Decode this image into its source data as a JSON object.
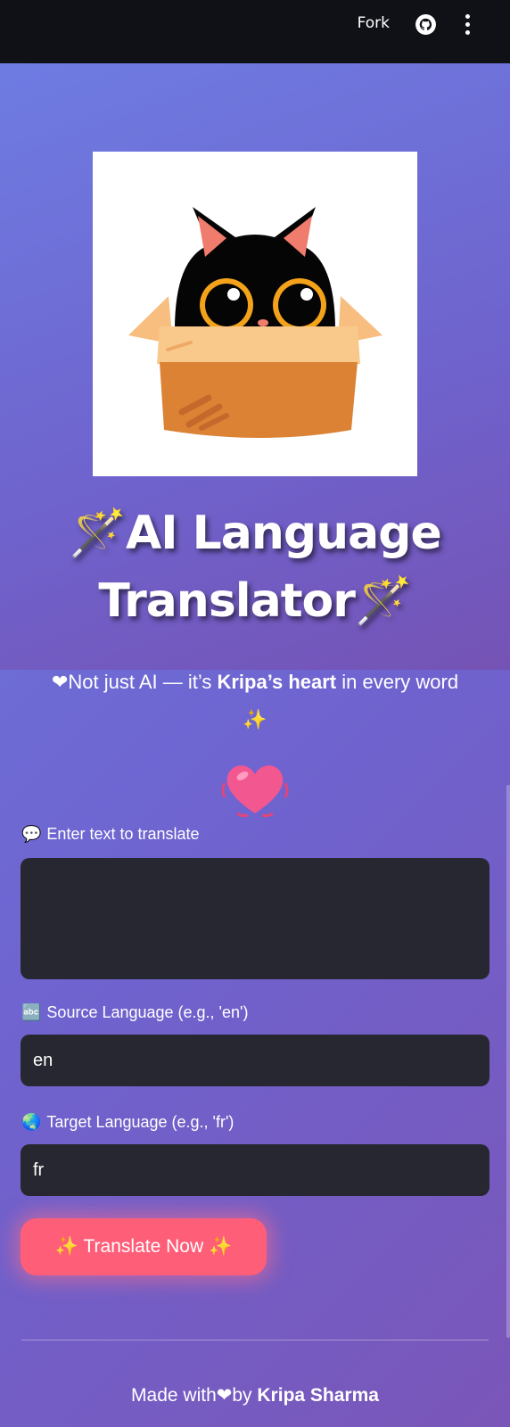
{
  "header": {
    "fork_label": "Fork",
    "github_icon": "github-icon",
    "menu_icon": "kebab-menu-icon"
  },
  "hero": {
    "mascot_icon": "cat-in-box-image",
    "title_line1": "🪄AI Language",
    "title_line2": "Translator🪄"
  },
  "tagline": {
    "heart": "❤",
    "prefix": "Not just AI — it’s ",
    "bold": "Kripa’s heart",
    "suffix": " in every word",
    "sparkles": "✨"
  },
  "heart_emoji": "💓",
  "form": {
    "text_label_icon": "💬",
    "text_label": "Enter text to translate",
    "text_value": "",
    "source_label_icon": "🔤",
    "source_label": "Source Language (e.g., 'en')",
    "source_value": "en",
    "target_label_icon": "🌏",
    "target_label": "Target Language (e.g., 'fr')",
    "target_value": "fr",
    "button_label": "✨ Translate Now ✨"
  },
  "footer": {
    "prefix": "Made with",
    "heart": "❤",
    "by": "by ",
    "author": "Kripa Sharma"
  },
  "colors": {
    "topbar": "#0f1117",
    "input_bg": "#262730",
    "button": "#ff5e79"
  }
}
